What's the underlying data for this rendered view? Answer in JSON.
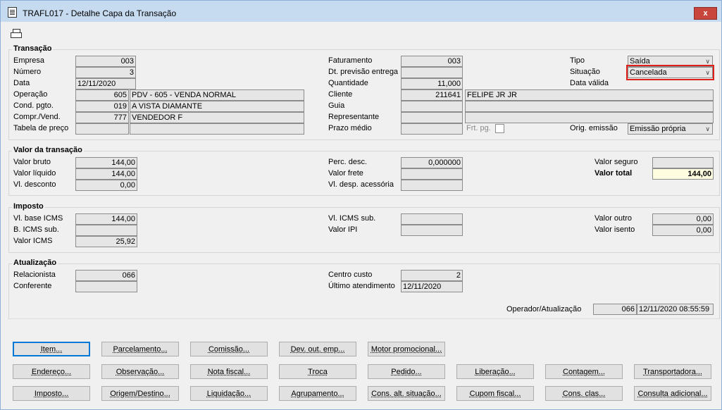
{
  "window": {
    "title": "TRAFL017 - Detalhe Capa da Transação",
    "close_label": "x"
  },
  "transacao": {
    "title": "Transação",
    "empresa_label": "Empresa",
    "empresa": "003",
    "numero_label": "Número",
    "numero": "3",
    "data_label": "Data",
    "data": "12/11/2020",
    "operacao_label": "Operação",
    "operacao_code": "605",
    "operacao_desc": "PDV - 605 - VENDA NORMAL",
    "cond_label": "Cond. pgto.",
    "cond_code": "019",
    "cond_desc": "A VISTA DIAMANTE",
    "compr_label": "Compr./Vend.",
    "compr_code": "777",
    "compr_desc": "VENDEDOR F",
    "tabela_label": "Tabela de preço",
    "faturamento_label": "Faturamento",
    "faturamento": "003",
    "dtprev_label": "Dt. previsão entrega",
    "quantidade_label": "Quantidade",
    "quantidade": "11,000",
    "cliente_label": "Cliente",
    "cliente_code": "211641",
    "cliente_name": "FELIPE JR JR",
    "guia_label": "Guia",
    "representante_label": "Representante",
    "prazo_label": "Prazo médio",
    "frt_label": "Frt. pg.",
    "tipo_label": "Tipo",
    "tipo": "Saída",
    "situacao_label": "Situação",
    "situacao": "Cancelada",
    "datavalida_label": "Data válida",
    "orig_label": "Orig. emissão",
    "orig": "Emissão própria"
  },
  "valor": {
    "title": "Valor da transação",
    "bruto_label": "Valor bruto",
    "bruto": "144,00",
    "liquido_label": "Valor líquido",
    "liquido": "144,00",
    "desconto_label": "Vl. desconto",
    "desconto": "0,00",
    "perc_label": "Perc. desc.",
    "perc": "0,000000",
    "frete_label": "Valor frete",
    "despesa_label": "Vl. desp. acessória",
    "seguro_label": "Valor seguro",
    "total_label": "Valor total",
    "total": "144,00"
  },
  "imposto": {
    "title": "Imposto",
    "base_label": "Vl. base ICMS",
    "base": "144,00",
    "bsub_label": "B. ICMS sub.",
    "icms_label": "Valor ICMS",
    "icms": "25,92",
    "icmssub_label": "Vl. ICMS sub.",
    "ipi_label": "Valor IPI",
    "outro_label": "Valor outro",
    "outro": "0,00",
    "isento_label": "Valor isento",
    "isento": "0,00"
  },
  "atualizacao": {
    "title": "Atualização",
    "relacionista_label": "Relacionista",
    "relacionista": "066",
    "conferente_label": "Conferente",
    "centro_label": "Centro custo",
    "centro": "2",
    "ultimo_label": "Último atendimento",
    "ultimo": "12/11/2020",
    "operador_label": "Operador/Atualização",
    "operador": "066",
    "operador_dt": "12/11/2020 08:55:59"
  },
  "buttons": {
    "row1": [
      "Item...",
      "Parcelamento...",
      "Comissão...",
      "Dev. out. emp...",
      "Motor promocional..."
    ],
    "row2": [
      "Endereço...",
      "Observação...",
      "Nota fiscal...",
      "Troca",
      "Pedido...",
      "Liberação...",
      "Contagem...",
      "Transportadora..."
    ],
    "row3": [
      "Imposto...",
      "Origem/Destino...",
      "Liquidação...",
      "Agrupamento...",
      "Cons. alt. situação...",
      "Cupom fiscal...",
      "Cons. clas...",
      "Consulta adicional..."
    ]
  },
  "colors": {
    "highlight_box": "#e0201b",
    "total_bg": "#fffde0",
    "titlebar": "#c6daf0"
  }
}
